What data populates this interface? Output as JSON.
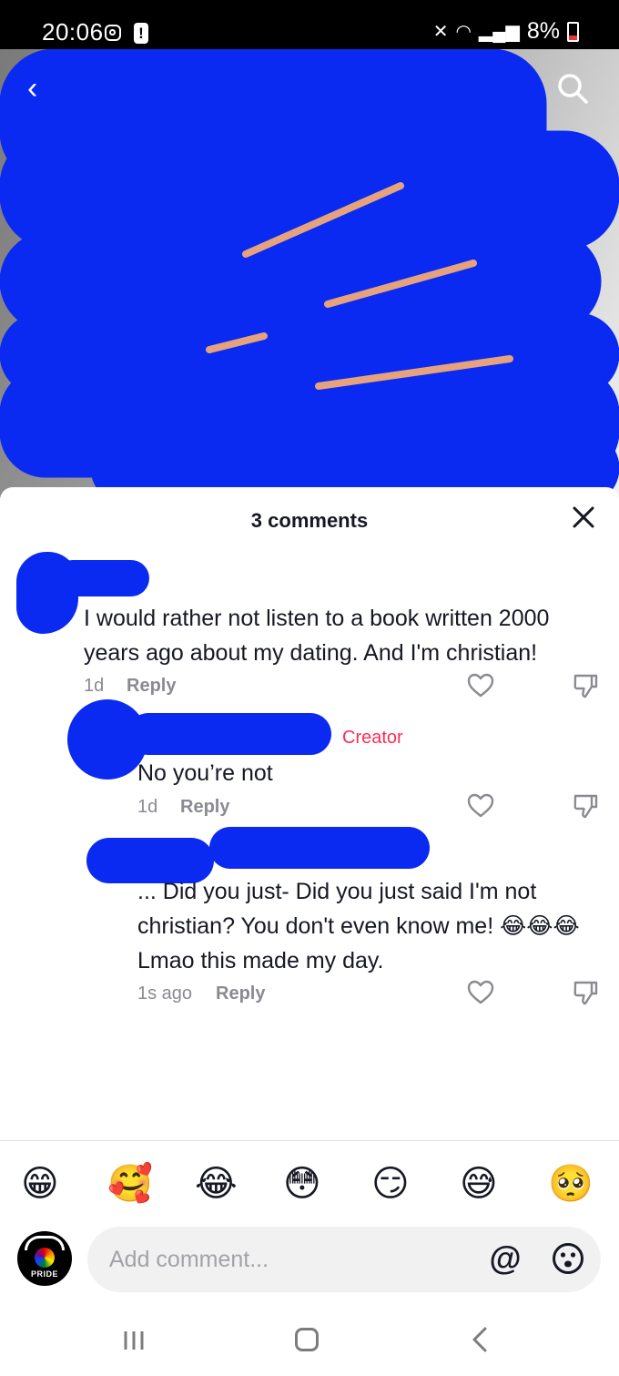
{
  "status": {
    "time": "20:06",
    "battery": "8%"
  },
  "sheet": {
    "title": "3 comments"
  },
  "comments": [
    {
      "text": "I would rather not listen to a book written 2000 years ago about my dating. And I'm christian!",
      "time": "1d",
      "reply": "Reply"
    },
    {
      "badge": "Creator",
      "text": "No you’re not",
      "time": "1d",
      "reply": "Reply"
    },
    {
      "text": "... Did you just- Did you just said I'm not christian? You don't even know me! 😂😂😂 Lmao this made my day.",
      "time": "1s ago",
      "reply": "Reply"
    }
  ],
  "quick_emojis": [
    "😁",
    "🥰",
    "😂",
    "😳",
    "😏",
    "😅",
    "🥺"
  ],
  "composer": {
    "placeholder": "Add comment...",
    "mention": "@",
    "avatar_text": "PRIDE"
  },
  "colors": {
    "creator": "#fe2c55",
    "redaction": "#0a2af2",
    "muted": "#8a8b91"
  },
  "icons": [
    "back-arrow-icon",
    "search-icon",
    "close-icon",
    "heart-icon",
    "dislike-icon",
    "mention-icon",
    "emoji-icon"
  ]
}
